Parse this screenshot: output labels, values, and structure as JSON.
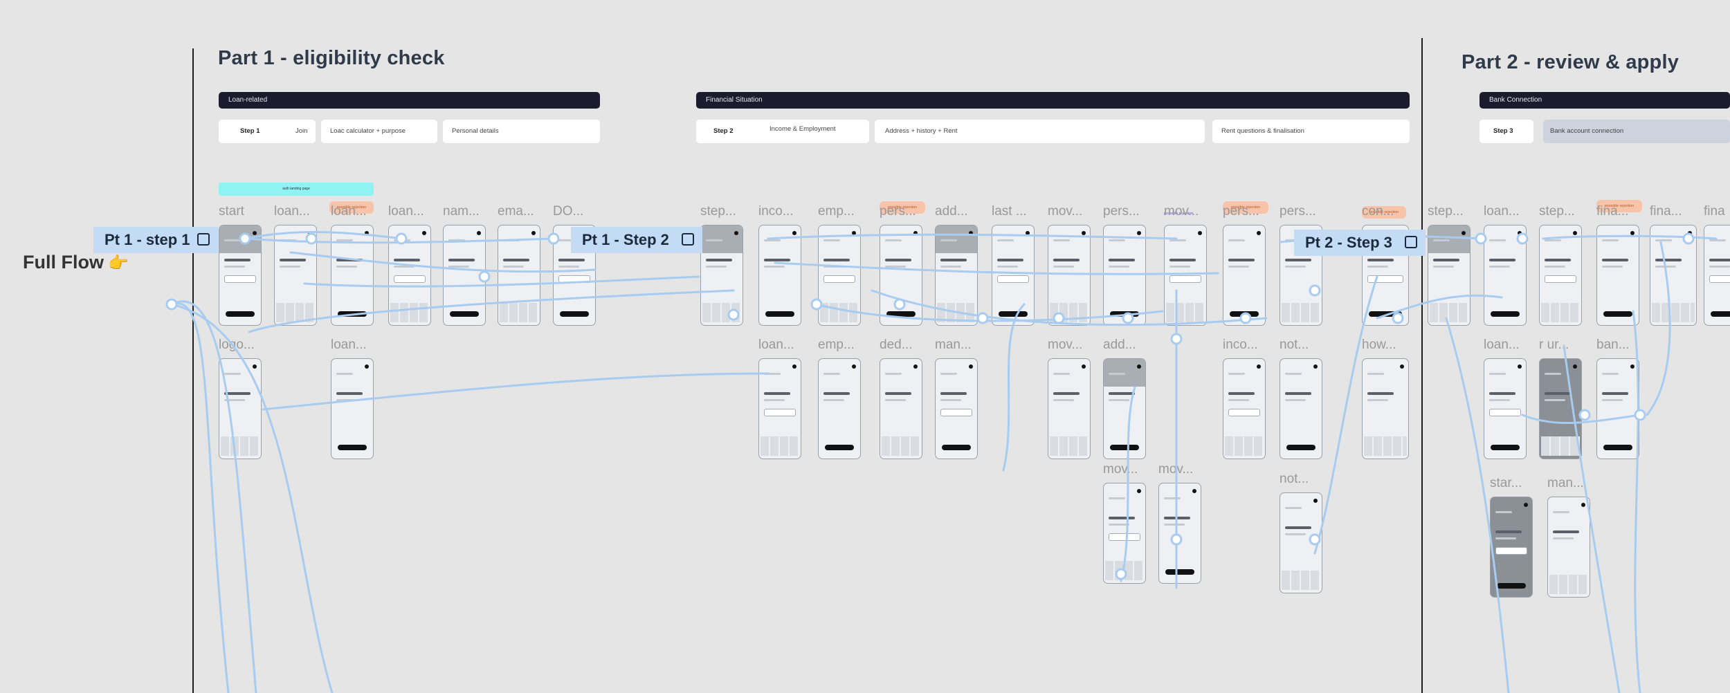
{
  "parts": {
    "part1_title": "Part 1 - eligibility check",
    "part2_title": "Part 2 - review & apply"
  },
  "full_flow": {
    "label": "Full Flow",
    "emoji": "👉"
  },
  "sections": {
    "loan_related": "Loan-related",
    "financial_situation": "Financial Situation",
    "bank_connection": "Bank Connection"
  },
  "steps": {
    "step1_num": "Step 1",
    "step1_label": "Join",
    "loan_calc": "Loac calculator + purpose",
    "personal_details": "Personal details",
    "step2_num": "Step 2",
    "step2_label": "Income & Employment",
    "address": "Address + history + Rent",
    "rent": "Rent questions & finalisation",
    "step3_num": "Step 3",
    "step3_label": "Bank account connection"
  },
  "banner": "auth landing page",
  "tags": {
    "possible_rejection": "possible rejection"
  },
  "screens_top": [
    "start",
    "loan...",
    "loan...",
    "loan...",
    "nam...",
    "ema...",
    "DO...",
    "step...",
    "inco...",
    "emp...",
    "pers...",
    "add...",
    "last ...",
    "mov...",
    "pers...",
    "mov...",
    "pers...",
    "pers...",
    "con...",
    "step...",
    "loan...",
    "step...",
    "fina...",
    "fina...",
    "fina"
  ],
  "screens_bottom": [
    "logo...",
    "loan...",
    "loan...",
    "emp...",
    "ded...",
    "man...",
    "mov...",
    "add...",
    "inco...",
    "not...",
    "how...",
    "loan...",
    "r ur...",
    "ban..."
  ],
  "screens_lower": [
    "mov...",
    "mov...",
    "not...",
    "star...",
    "man..."
  ],
  "callouts": {
    "pt1_step1": "Pt 1 - step 1",
    "pt1_step2": "Pt 1 - Step 2",
    "pt2_step3": "Pt 2 - Step 3"
  },
  "colors": {
    "background": "#e5e5e5",
    "section_bar": "#1c1b2d",
    "connector": "#a8ccf0",
    "callout": "#c3dbf4",
    "tag": "#f7c4a9",
    "banner": "#8ff2f3"
  }
}
